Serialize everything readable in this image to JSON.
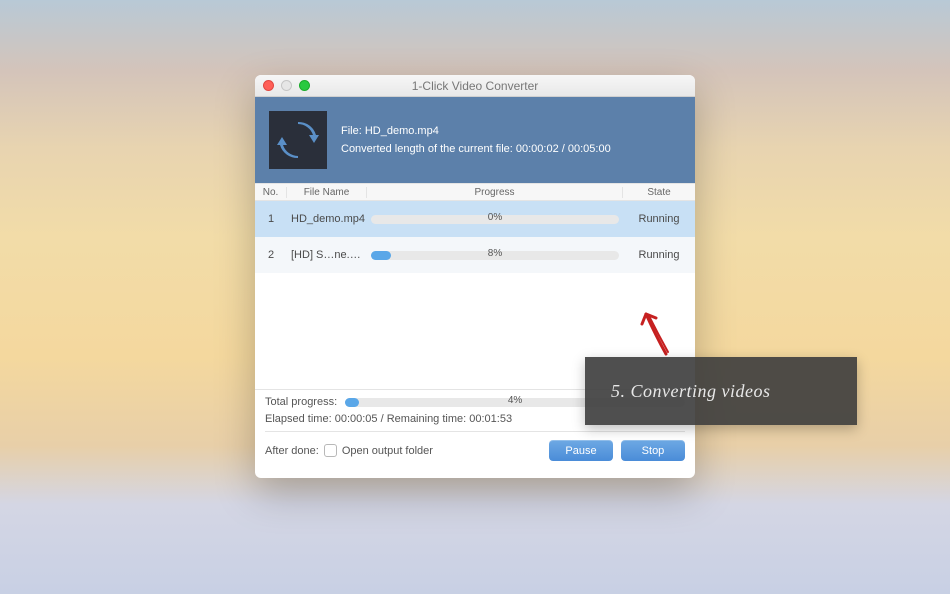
{
  "window": {
    "title": "1-Click Video Converter"
  },
  "header": {
    "file_label": "File:",
    "file_name": "HD_demo.mp4",
    "converted_prefix": "Converted length of the current file:",
    "converted_time": "00:00:02",
    "total_time": "00:05:00"
  },
  "table": {
    "columns": {
      "no": "No.",
      "file": "File Name",
      "progress": "Progress",
      "state": "State"
    },
    "rows": [
      {
        "no": "1",
        "file": "HD_demo.mp4",
        "progress_pct": 0,
        "progress_label": "0%",
        "state": "Running"
      },
      {
        "no": "2",
        "file": "[HD] S…ne.mp4",
        "progress_pct": 8,
        "progress_label": "8%",
        "state": "Running"
      }
    ]
  },
  "footer": {
    "total_label": "Total progress:",
    "total_pct": 4,
    "total_pct_label": "4%",
    "elapsed_label": "Elapsed time:",
    "elapsed_time": "00:00:05",
    "remaining_label": "Remaining time:",
    "remaining_time": "00:01:53",
    "after_done_label": "After done:",
    "open_output_label": "Open output folder",
    "pause_label": "Pause",
    "stop_label": "Stop"
  },
  "callout": {
    "text": "5. Converting videos"
  }
}
